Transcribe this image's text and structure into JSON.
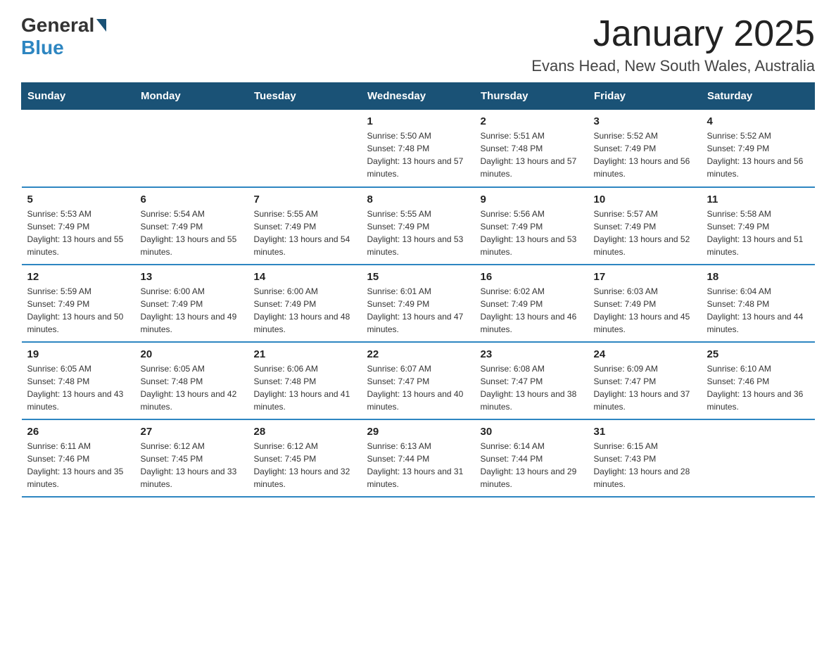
{
  "header": {
    "logo_general": "General",
    "logo_blue": "Blue",
    "main_title": "January 2025",
    "subtitle": "Evans Head, New South Wales, Australia"
  },
  "weekdays": [
    "Sunday",
    "Monday",
    "Tuesday",
    "Wednesday",
    "Thursday",
    "Friday",
    "Saturday"
  ],
  "weeks": [
    [
      {
        "day": "",
        "sunrise": "",
        "sunset": "",
        "daylight": ""
      },
      {
        "day": "",
        "sunrise": "",
        "sunset": "",
        "daylight": ""
      },
      {
        "day": "",
        "sunrise": "",
        "sunset": "",
        "daylight": ""
      },
      {
        "day": "1",
        "sunrise": "Sunrise: 5:50 AM",
        "sunset": "Sunset: 7:48 PM",
        "daylight": "Daylight: 13 hours and 57 minutes."
      },
      {
        "day": "2",
        "sunrise": "Sunrise: 5:51 AM",
        "sunset": "Sunset: 7:48 PM",
        "daylight": "Daylight: 13 hours and 57 minutes."
      },
      {
        "day": "3",
        "sunrise": "Sunrise: 5:52 AM",
        "sunset": "Sunset: 7:49 PM",
        "daylight": "Daylight: 13 hours and 56 minutes."
      },
      {
        "day": "4",
        "sunrise": "Sunrise: 5:52 AM",
        "sunset": "Sunset: 7:49 PM",
        "daylight": "Daylight: 13 hours and 56 minutes."
      }
    ],
    [
      {
        "day": "5",
        "sunrise": "Sunrise: 5:53 AM",
        "sunset": "Sunset: 7:49 PM",
        "daylight": "Daylight: 13 hours and 55 minutes."
      },
      {
        "day": "6",
        "sunrise": "Sunrise: 5:54 AM",
        "sunset": "Sunset: 7:49 PM",
        "daylight": "Daylight: 13 hours and 55 minutes."
      },
      {
        "day": "7",
        "sunrise": "Sunrise: 5:55 AM",
        "sunset": "Sunset: 7:49 PM",
        "daylight": "Daylight: 13 hours and 54 minutes."
      },
      {
        "day": "8",
        "sunrise": "Sunrise: 5:55 AM",
        "sunset": "Sunset: 7:49 PM",
        "daylight": "Daylight: 13 hours and 53 minutes."
      },
      {
        "day": "9",
        "sunrise": "Sunrise: 5:56 AM",
        "sunset": "Sunset: 7:49 PM",
        "daylight": "Daylight: 13 hours and 53 minutes."
      },
      {
        "day": "10",
        "sunrise": "Sunrise: 5:57 AM",
        "sunset": "Sunset: 7:49 PM",
        "daylight": "Daylight: 13 hours and 52 minutes."
      },
      {
        "day": "11",
        "sunrise": "Sunrise: 5:58 AM",
        "sunset": "Sunset: 7:49 PM",
        "daylight": "Daylight: 13 hours and 51 minutes."
      }
    ],
    [
      {
        "day": "12",
        "sunrise": "Sunrise: 5:59 AM",
        "sunset": "Sunset: 7:49 PM",
        "daylight": "Daylight: 13 hours and 50 minutes."
      },
      {
        "day": "13",
        "sunrise": "Sunrise: 6:00 AM",
        "sunset": "Sunset: 7:49 PM",
        "daylight": "Daylight: 13 hours and 49 minutes."
      },
      {
        "day": "14",
        "sunrise": "Sunrise: 6:00 AM",
        "sunset": "Sunset: 7:49 PM",
        "daylight": "Daylight: 13 hours and 48 minutes."
      },
      {
        "day": "15",
        "sunrise": "Sunrise: 6:01 AM",
        "sunset": "Sunset: 7:49 PM",
        "daylight": "Daylight: 13 hours and 47 minutes."
      },
      {
        "day": "16",
        "sunrise": "Sunrise: 6:02 AM",
        "sunset": "Sunset: 7:49 PM",
        "daylight": "Daylight: 13 hours and 46 minutes."
      },
      {
        "day": "17",
        "sunrise": "Sunrise: 6:03 AM",
        "sunset": "Sunset: 7:49 PM",
        "daylight": "Daylight: 13 hours and 45 minutes."
      },
      {
        "day": "18",
        "sunrise": "Sunrise: 6:04 AM",
        "sunset": "Sunset: 7:48 PM",
        "daylight": "Daylight: 13 hours and 44 minutes."
      }
    ],
    [
      {
        "day": "19",
        "sunrise": "Sunrise: 6:05 AM",
        "sunset": "Sunset: 7:48 PM",
        "daylight": "Daylight: 13 hours and 43 minutes."
      },
      {
        "day": "20",
        "sunrise": "Sunrise: 6:05 AM",
        "sunset": "Sunset: 7:48 PM",
        "daylight": "Daylight: 13 hours and 42 minutes."
      },
      {
        "day": "21",
        "sunrise": "Sunrise: 6:06 AM",
        "sunset": "Sunset: 7:48 PM",
        "daylight": "Daylight: 13 hours and 41 minutes."
      },
      {
        "day": "22",
        "sunrise": "Sunrise: 6:07 AM",
        "sunset": "Sunset: 7:47 PM",
        "daylight": "Daylight: 13 hours and 40 minutes."
      },
      {
        "day": "23",
        "sunrise": "Sunrise: 6:08 AM",
        "sunset": "Sunset: 7:47 PM",
        "daylight": "Daylight: 13 hours and 38 minutes."
      },
      {
        "day": "24",
        "sunrise": "Sunrise: 6:09 AM",
        "sunset": "Sunset: 7:47 PM",
        "daylight": "Daylight: 13 hours and 37 minutes."
      },
      {
        "day": "25",
        "sunrise": "Sunrise: 6:10 AM",
        "sunset": "Sunset: 7:46 PM",
        "daylight": "Daylight: 13 hours and 36 minutes."
      }
    ],
    [
      {
        "day": "26",
        "sunrise": "Sunrise: 6:11 AM",
        "sunset": "Sunset: 7:46 PM",
        "daylight": "Daylight: 13 hours and 35 minutes."
      },
      {
        "day": "27",
        "sunrise": "Sunrise: 6:12 AM",
        "sunset": "Sunset: 7:45 PM",
        "daylight": "Daylight: 13 hours and 33 minutes."
      },
      {
        "day": "28",
        "sunrise": "Sunrise: 6:12 AM",
        "sunset": "Sunset: 7:45 PM",
        "daylight": "Daylight: 13 hours and 32 minutes."
      },
      {
        "day": "29",
        "sunrise": "Sunrise: 6:13 AM",
        "sunset": "Sunset: 7:44 PM",
        "daylight": "Daylight: 13 hours and 31 minutes."
      },
      {
        "day": "30",
        "sunrise": "Sunrise: 6:14 AM",
        "sunset": "Sunset: 7:44 PM",
        "daylight": "Daylight: 13 hours and 29 minutes."
      },
      {
        "day": "31",
        "sunrise": "Sunrise: 6:15 AM",
        "sunset": "Sunset: 7:43 PM",
        "daylight": "Daylight: 13 hours and 28 minutes."
      },
      {
        "day": "",
        "sunrise": "",
        "sunset": "",
        "daylight": ""
      }
    ]
  ]
}
